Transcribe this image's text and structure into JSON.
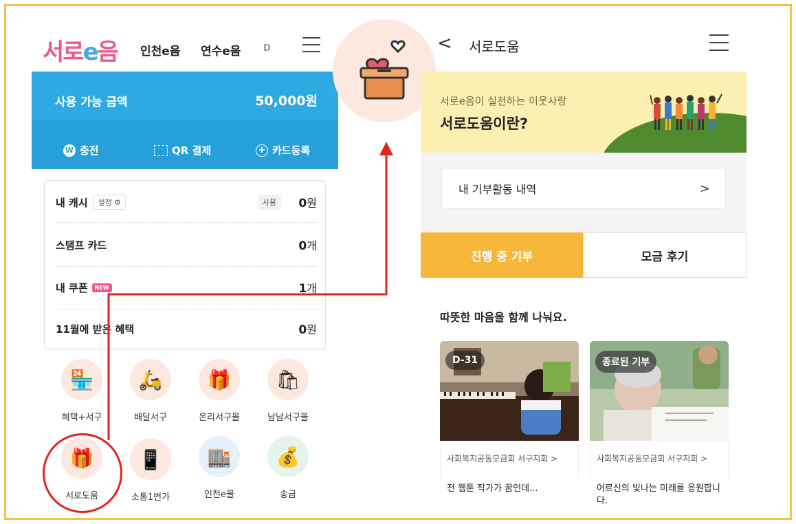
{
  "left": {
    "logo": {
      "part1": "서로",
      "part2": "e",
      "part3": "음"
    },
    "top_tabs": [
      "인천e음",
      "연수e음",
      "D"
    ],
    "balance": {
      "label": "사용 가능 금액",
      "amount": "50,000원"
    },
    "actions": [
      {
        "label": "충전",
        "icon": "w-circle-icon",
        "icon_text": "W"
      },
      {
        "label": "QR 결제",
        "icon": "qr-icon"
      },
      {
        "label": "카드등록",
        "icon": "plus-circle-icon",
        "icon_text": "+"
      }
    ],
    "cash": {
      "label": "내 캐시",
      "setting_label": "설정",
      "use_label": "사용",
      "value": "0",
      "unit": "원"
    },
    "stamp": {
      "label": "스탬프 카드",
      "value": "0",
      "unit": "개"
    },
    "coupon": {
      "label": "내 쿠폰",
      "badge": "NEW",
      "value": "1",
      "unit": "개"
    },
    "benefit": {
      "label": "11월에 받은 혜택",
      "value": "0",
      "unit": "원"
    },
    "menus": [
      {
        "label": "혜택+서구",
        "icon": "storefront-icon",
        "glyph": "🏪"
      },
      {
        "label": "배달서구",
        "icon": "delivery-scooter-icon",
        "glyph": "🛵"
      },
      {
        "label": "온리서구몰",
        "icon": "gift-hand-icon",
        "glyph": "🎁"
      },
      {
        "label": "남남서구몰",
        "icon": "shopping-bag-icon",
        "glyph": "🛍"
      },
      {
        "label": "서로도움",
        "icon": "donation-box-icon",
        "glyph": "🎁"
      },
      {
        "label": "소통1번가",
        "icon": "phone-hand-icon",
        "glyph": "📱"
      },
      {
        "label": "인천e몰",
        "icon": "shop-icon",
        "glyph": "🏬"
      },
      {
        "label": "송금",
        "icon": "money-bag-icon",
        "glyph": "💰"
      }
    ]
  },
  "right": {
    "header": {
      "back_glyph": "<",
      "title": "서로도움"
    },
    "banner": {
      "subtitle": "서로e음이 실천하는 이웃사랑",
      "title": "서로도움이란?"
    },
    "donation_history": {
      "label": "내 기부활동 내역",
      "chevron": ">"
    },
    "tabs": [
      {
        "label": "진행 중 기부",
        "active": true
      },
      {
        "label": "모금 후기",
        "active": false
      }
    ],
    "section_title": "따뜻한 마음을 함께 나눠요.",
    "cards": [
      {
        "badge": "D-31",
        "org": "사회복지공동모금회 서구지회 >",
        "title": "전 웹툰 작가가 꿈인데..."
      },
      {
        "badge": "종료된 기부",
        "org": "사회복지공동모금회 서구지회 >",
        "title": "어르신의 빛나는 미래를 응원합니다."
      }
    ]
  },
  "colors": {
    "frame": "#f2c14e",
    "balance_bg": "#2fa9e1",
    "tab_active": "#f7b73a",
    "banner_bg": "#fbf0b2",
    "highlight_red": "#e3241c",
    "brand_pink": "#ec5a8e",
    "brand_blue": "#4da3e6"
  }
}
